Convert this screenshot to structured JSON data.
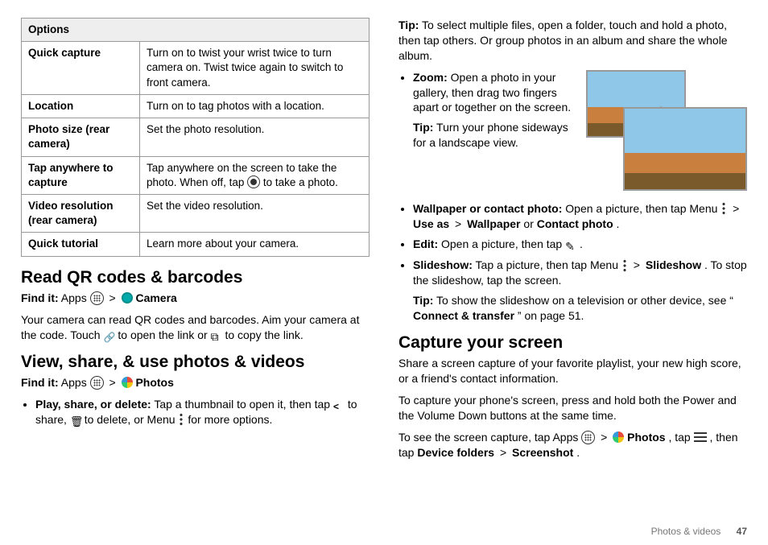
{
  "table": {
    "header": "Options",
    "rows": [
      {
        "k": "Quick capture",
        "v": "Turn on to twist your wrist twice to turn camera on. Twist twice again to switch to front camera."
      },
      {
        "k": "Location",
        "v": "Turn on to tag photos with a location."
      },
      {
        "k": "Photo size (rear camera)",
        "v": "Set the photo resolution."
      },
      {
        "k": "Tap anywhere to capture",
        "v_pre": "Tap anywhere on the screen to take the photo. When off, tap ",
        "v_post": " to take a photo."
      },
      {
        "k": "Video resolution (rear camera)",
        "v": "Set the video resolution."
      },
      {
        "k": "Quick tutorial",
        "v": "Learn more about your camera."
      }
    ]
  },
  "qr": {
    "heading": "Read QR codes & barcodes",
    "find_label": "Find it:",
    "find_apps": "Apps",
    "find_app": "Camera",
    "body_pre": "Your camera can read QR codes and barcodes. Aim your camera at the code. Touch ",
    "body_mid": " to open the link or ",
    "body_post": " to copy the link."
  },
  "view": {
    "heading": "View, share, & use photos & videos",
    "find_label": "Find it:",
    "find_apps": "Apps",
    "find_app": "Photos",
    "b1_lead": "Play, share, or delete:",
    "b1_pre": " Tap a thumbnail to open it, then tap ",
    "b1_share": " to share, ",
    "b1_delete": " to delete, or Menu ",
    "b1_post": " for more options."
  },
  "right": {
    "tip_lead": "Tip:",
    "tip_body": " To select multiple files, open a folder, touch and hold a photo, then tap others. Or group photos in an album and share the whole album.",
    "zoom_lead": "Zoom:",
    "zoom_body": " Open a photo in your gallery, then drag two fingers apart or together on the screen.",
    "zoom_tip_lead": "Tip:",
    "zoom_tip_body": " Turn your phone sideways for a landscape view.",
    "wall_lead": "Wallpaper or contact photo:",
    "wall_pre": " Open a picture, then tap Menu ",
    "wall_gt": ">",
    "wall_useas": "Use as",
    "wall_wall": "Wallpaper",
    "wall_or": " or ",
    "wall_contact": "Contact photo",
    "wall_end": ".",
    "edit_lead": "Edit:",
    "edit_body": " Open a picture, then tap ",
    "edit_end": ".",
    "slide_lead": "Slideshow:",
    "slide_pre": " Tap a picture, then tap Menu ",
    "slide_gt": ">",
    "slide_name": "Slideshow",
    "slide_post": ". To stop the slideshow, tap the screen.",
    "slide_tip_lead": "Tip:",
    "slide_tip_pre": " To show the slideshow on a television or other device, see “",
    "slide_tip_link": "Connect & transfer",
    "slide_tip_post": "” on page 51."
  },
  "capture": {
    "heading": "Capture your screen",
    "p1": "Share a screen capture of your favorite playlist, your new high score, or a friend's contact information.",
    "p2": "To capture your phone's screen, press and hold both the Power and the Volume Down buttons at the same time.",
    "p3_pre": "To see the screen capture, tap Apps ",
    "p3_gt": ">",
    "p3_photos": "Photos",
    "p3_tap": ", tap ",
    "p3_then": ", then tap ",
    "p3_devf": "Device folders",
    "p3_gt2": ">",
    "p3_ss": "Screenshot",
    "p3_end": "."
  },
  "footer": {
    "section": "Photos & videos",
    "page": "47"
  },
  "gt": ">"
}
